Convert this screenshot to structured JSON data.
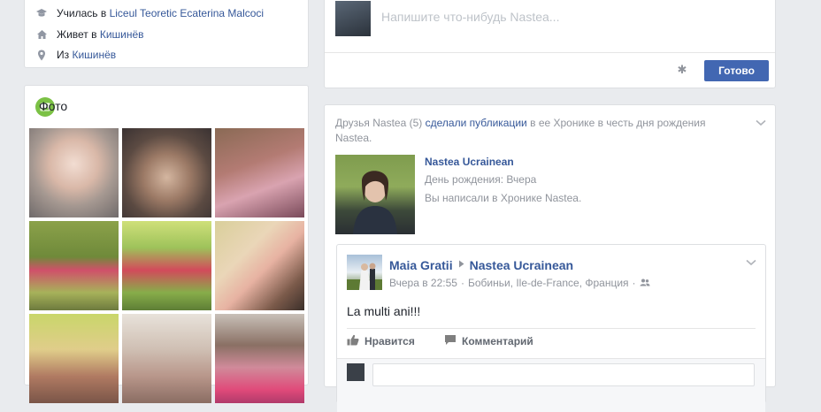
{
  "intro": {
    "studied_prefix": "Училась в",
    "studied_place": "Liceul Teoretic Ecaterina Malcoci",
    "lives_prefix": "Живет в",
    "lives_place": "Кишинёв",
    "from_prefix": "Из",
    "from_place": "Кишинёв"
  },
  "photos": {
    "title": "Фото"
  },
  "composer": {
    "placeholder": "Напишите что-нибудь Nastea...",
    "post_button": "Готово"
  },
  "feed": {
    "bday_line_part1": "Друзья Nastea (5)",
    "bday_line_link": "сделали публикации",
    "bday_line_part2": "в ее Хронике в честь дня рождения Nastea.",
    "bday_name": "Nastea Ucrainean",
    "bday_date": "День рождения: Вчера",
    "bday_wrote": "Вы написали в Хронике Nastea."
  },
  "post": {
    "author": "Maia Gratii",
    "target": "Nastea Ucrainean",
    "time": "Вчера в 22:55",
    "location": "Бобиньи, Ile-de-France, Франция",
    "separator": "·",
    "text": "La multi ani!!!",
    "like_label": "Нравится",
    "comment_label": "Комментарий"
  },
  "icons": {
    "school": "graduation-cap-icon",
    "home": "home-icon",
    "pin": "location-pin-icon",
    "photo": "photo-icon",
    "like": "thumbs-up-icon",
    "comment": "comment-icon",
    "settings": "gear-icon",
    "friends": "friends-icon",
    "chevron": "chevron-down-icon"
  },
  "colors": {
    "brand": "#4267b2",
    "link": "#365899",
    "background": "#e9ebee",
    "photo_icon": "#7bc145"
  }
}
